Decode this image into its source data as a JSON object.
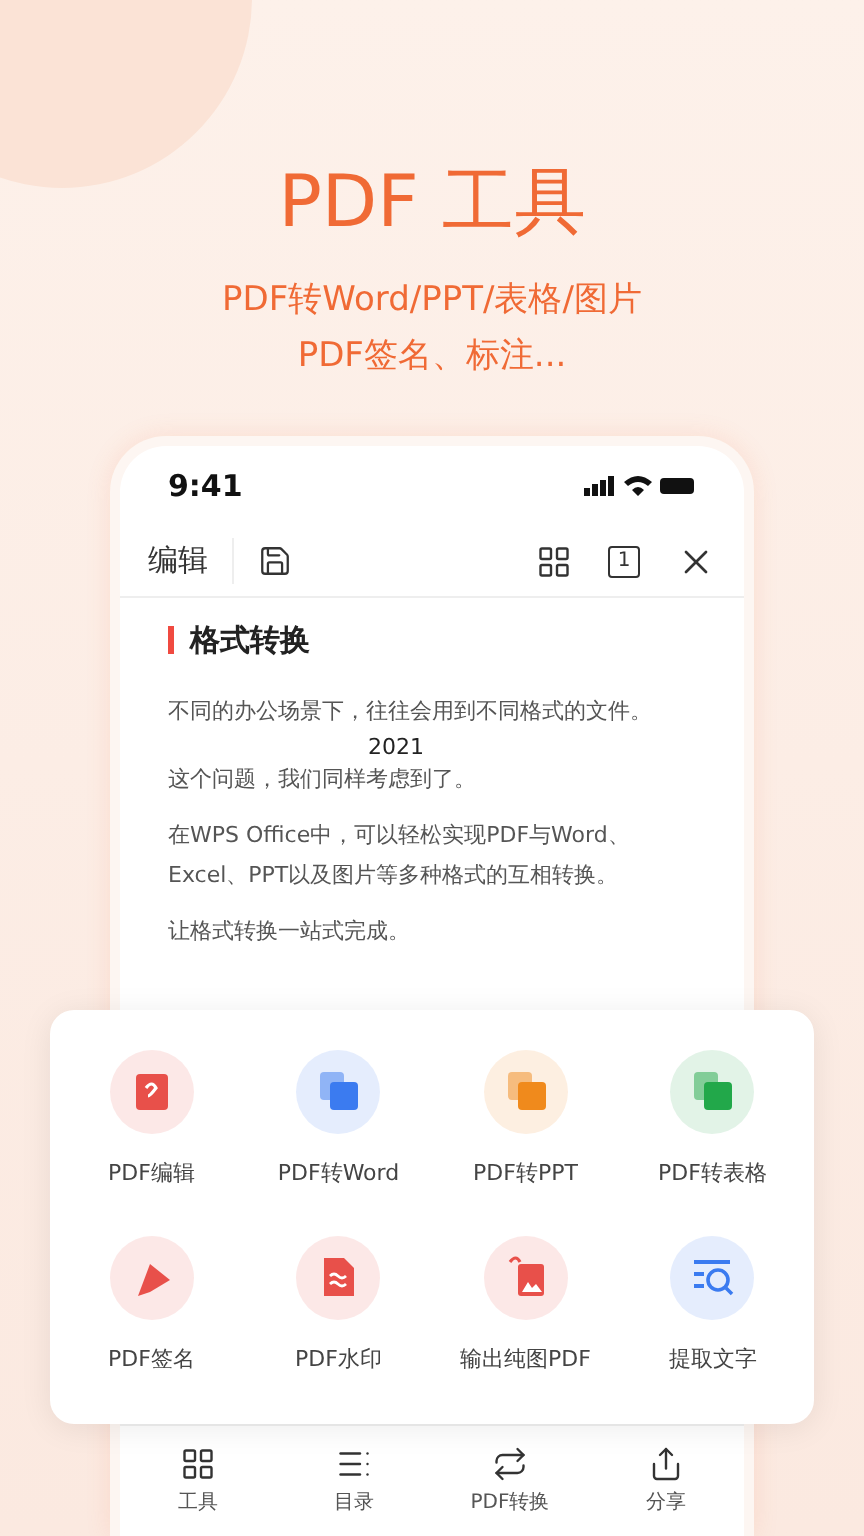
{
  "hero": {
    "title": "PDF 工具",
    "subtitle_lines": [
      "PDF转Word/PPT/表格/图片",
      "PDF签名、标注..."
    ]
  },
  "status_bar": {
    "time": "9:41"
  },
  "toolbar": {
    "edit_label": "编辑",
    "page_number": "1"
  },
  "document": {
    "heading": "格式转换",
    "paragraphs": [
      "不同的办公场景下，往往会用到不同格式的文件。",
      "这个问题，我们同样考虑到了。",
      "在WPS Office中，可以轻松实现PDF与Word、Excel、PPT以及图片等多种格式的互相转换。",
      "让格式转换一站式完成。"
    ],
    "stamp": "2021"
  },
  "tools": [
    {
      "label": "PDF编辑",
      "kind": "edit",
      "color": "#e8504a"
    },
    {
      "label": "PDF转Word",
      "kind": "word",
      "color": "#3b7bf0"
    },
    {
      "label": "PDF转PPT",
      "kind": "ppt",
      "color": "#f08a1c"
    },
    {
      "label": "PDF转表格",
      "kind": "sheet",
      "color": "#22a84a"
    },
    {
      "label": "PDF签名",
      "kind": "sign",
      "color": "#e8504a"
    },
    {
      "label": "PDF水印",
      "kind": "watermark",
      "color": "#e8504a"
    },
    {
      "label": "输出纯图PDF",
      "kind": "image",
      "color": "#e8504a"
    },
    {
      "label": "提取文字",
      "kind": "ocr",
      "color": "#3b7bf0"
    }
  ],
  "bottom_nav": [
    {
      "label": "工具",
      "kind": "tools"
    },
    {
      "label": "目录",
      "kind": "outline"
    },
    {
      "label": "PDF转换",
      "kind": "convert"
    },
    {
      "label": "分享",
      "kind": "share"
    }
  ]
}
